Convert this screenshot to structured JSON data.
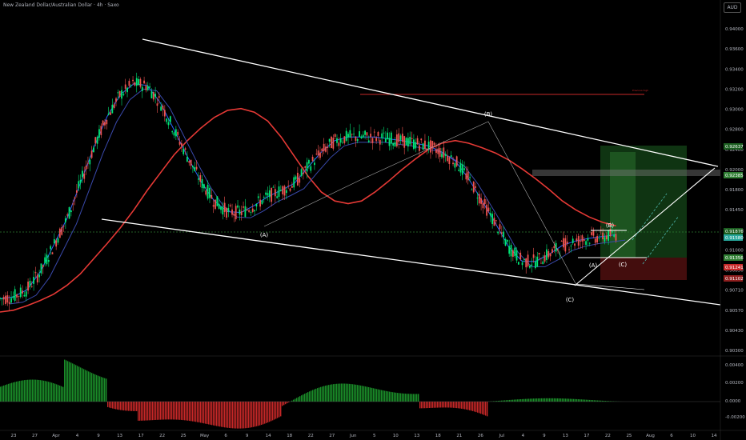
{
  "header": {
    "title": "New Zealand Dollar/Australian Dollar · 4h · Saxo",
    "currency": "AUD"
  },
  "colors": {
    "background": "#000000",
    "up": "#26a69a",
    "up_bright": "#00e676",
    "down": "#ef5350",
    "ma_red": "#e53935",
    "ma_blue": "#2962ff",
    "ma_navy": "#3949ab",
    "trendline": "#ffffff",
    "target_zone": "#1b5e20",
    "stop_zone": "#4a0e0e"
  },
  "chart_data": {
    "type": "line",
    "x_tick_labels": [
      "23",
      "27",
      "Apr",
      "4",
      "9",
      "13",
      "17",
      "22",
      "25",
      "May",
      "6",
      "9",
      "14",
      "18",
      "22",
      "27",
      "Jun",
      "5",
      "10",
      "13",
      "18",
      "21",
      "26",
      "Jul",
      "4",
      "9",
      "13",
      "17",
      "22",
      "25",
      "Aug",
      "6",
      "10",
      "14"
    ],
    "y_tick_labels": [
      "0.94000",
      "0.93600",
      "0.93400",
      "0.93200",
      "0.93000",
      "0.92800",
      "0.92400",
      "0.92000",
      "0.91800",
      "0.91450",
      "0.91150",
      "0.91000",
      "0.90850",
      "0.90710",
      "0.90570",
      "0.90430",
      "0.90300"
    ],
    "price_labels": [
      {
        "text": "0.92637",
        "color": "#1b5e20"
      },
      {
        "text": "0.92385",
        "color": "#2e7d32"
      },
      {
        "text": "0.91876",
        "color": "#1b5e20"
      },
      {
        "text": "0.91580",
        "color": "#26a69a"
      },
      {
        "text": "0.91356",
        "color": "#2e7d32"
      },
      {
        "text": "0.91241",
        "color": "#c62828"
      },
      {
        "text": "0.91102",
        "color": "#8e1e1e"
      }
    ],
    "wave_labels": [
      "(A)",
      "(B)",
      "(C)",
      "(A)",
      "(B)",
      "(C)"
    ],
    "annotation": "Previous high",
    "oscillator_ticks": [
      "0.00400",
      "0.00200",
      "0.0000",
      "-0.00200"
    ],
    "series": [
      {
        "color": "#e53935",
        "values": [
          0.9075,
          0.9077,
          0.9082,
          0.9088,
          0.9095,
          0.9105,
          0.9118,
          0.9135,
          0.9152,
          0.917,
          0.919,
          0.9212,
          0.9232,
          0.9252,
          0.9268,
          0.9282,
          0.9294,
          0.9302,
          0.9304,
          0.93,
          0.929,
          0.9272,
          0.925,
          0.9228,
          0.921,
          0.92,
          0.9197,
          0.92,
          0.921,
          0.9222,
          0.9235,
          0.9247,
          0.9258,
          0.9265,
          0.9268,
          0.9265,
          0.926,
          0.9254,
          0.9246,
          0.9236,
          0.9225,
          0.9213,
          0.92,
          0.919,
          0.9182,
          0.9176,
          0.9172
        ]
      },
      {
        "color": "#2962ff",
        "values": [
          0.909,
          0.9092,
          0.91,
          0.912,
          0.915,
          0.918,
          0.922,
          0.926,
          0.9295,
          0.932,
          0.9332,
          0.933,
          0.931,
          0.928,
          0.925,
          0.9222,
          0.92,
          0.9188,
          0.9187,
          0.9195,
          0.9205,
          0.9212,
          0.922,
          0.9238,
          0.9255,
          0.9268,
          0.9272,
          0.9272,
          0.9272,
          0.927,
          0.9268,
          0.9265,
          0.9262,
          0.9255,
          0.9245,
          0.9225,
          0.92,
          0.9175,
          0.9148,
          0.9132,
          0.9132,
          0.914,
          0.915,
          0.9155,
          0.9158,
          0.916,
          0.9162
        ]
      }
    ],
    "xlim": [
      0,
      46
    ],
    "ylim": [
      0.903,
      0.941
    ],
    "grid": false,
    "legend": "none"
  }
}
